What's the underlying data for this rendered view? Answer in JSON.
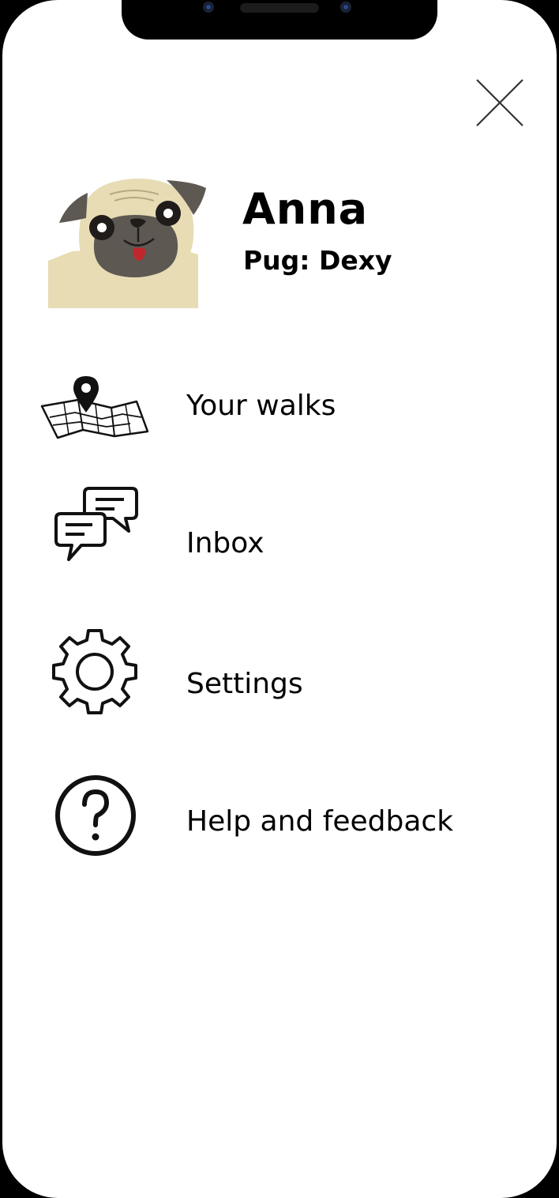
{
  "profile": {
    "name": "Anna",
    "pet": "Pug: Dexy",
    "avatar_icon": "pug-icon"
  },
  "close_icon": "close-icon",
  "menu": [
    {
      "label": "Your walks",
      "icon": "map-pin-icon"
    },
    {
      "label": "Inbox",
      "icon": "chat-bubbles-icon"
    },
    {
      "label": "Settings",
      "icon": "gear-icon"
    },
    {
      "label": "Help and feedback",
      "icon": "question-circle-icon"
    }
  ],
  "colors": {
    "background": "#ffffff",
    "text": "#000000",
    "pug_fur": "#e8dcb5",
    "pug_mask": "#5e5852",
    "pug_tongue": "#c0272d"
  }
}
